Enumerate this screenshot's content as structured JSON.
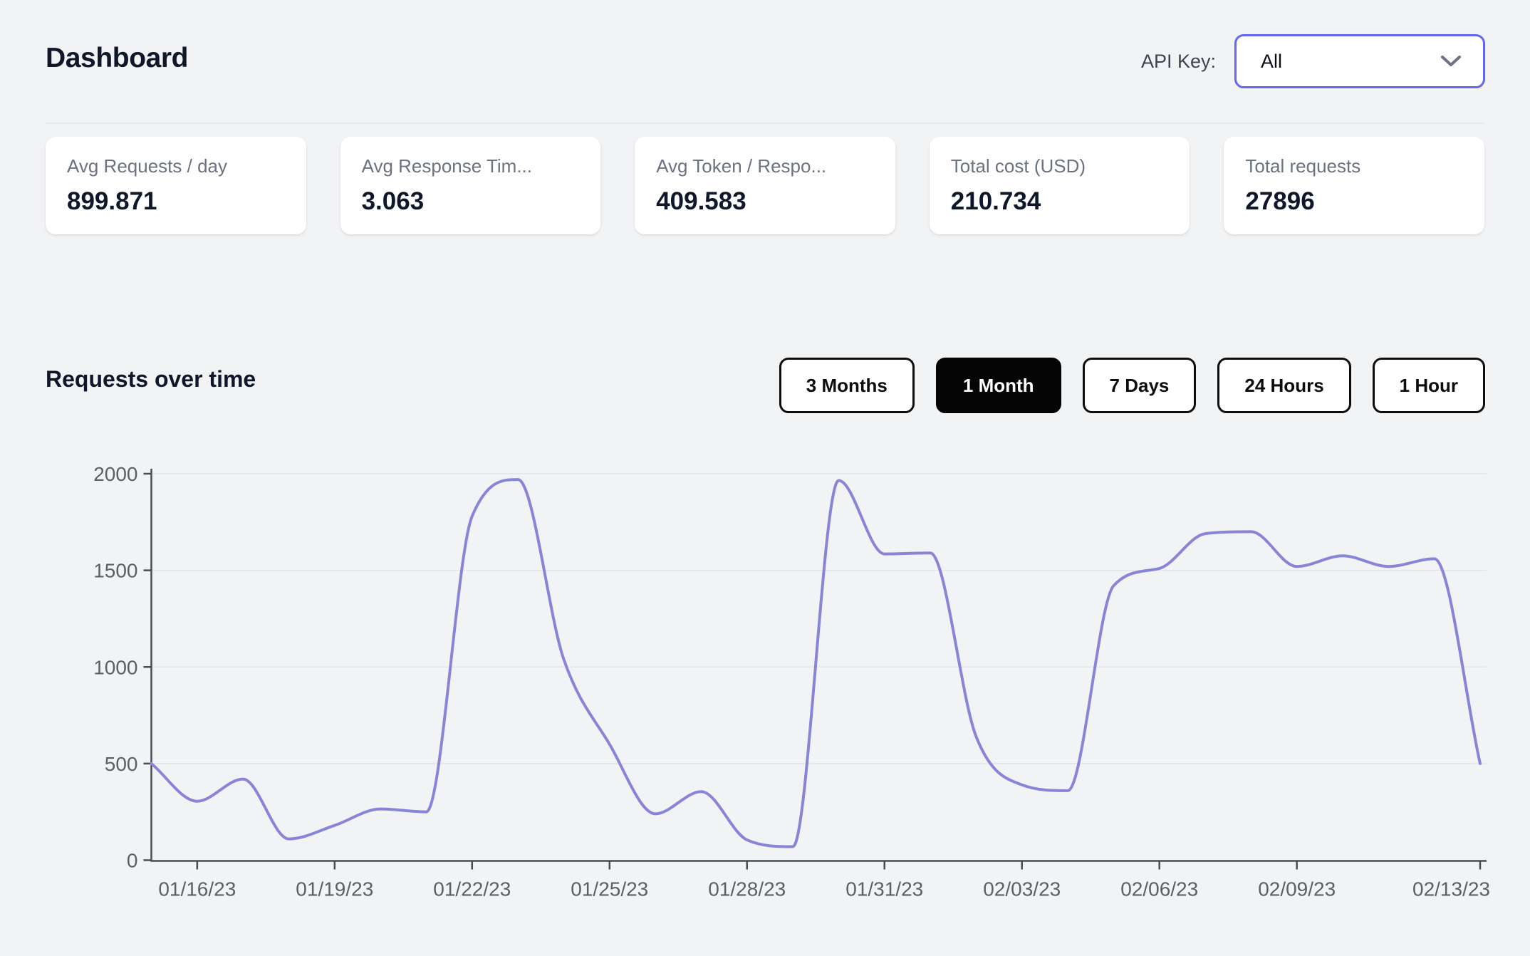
{
  "theme": {
    "background": "#f2f3f5",
    "accent": "#6366f1",
    "active_button_bg": "#050505"
  },
  "header": {
    "title": "Dashboard",
    "api_key_label": "API Key:",
    "api_key_value": "All"
  },
  "stats": [
    {
      "label": "Avg Requests / day",
      "value": "899.871"
    },
    {
      "label": "Avg Response Tim...",
      "value": "3.063"
    },
    {
      "label": "Avg Token / Respo...",
      "value": "409.583"
    },
    {
      "label": "Total cost (USD)",
      "value": "210.734"
    },
    {
      "label": "Total requests",
      "value": "27896"
    }
  ],
  "section": {
    "title": "Requests over time",
    "ranges": [
      {
        "label": "3 Months",
        "active": false
      },
      {
        "label": "1 Month",
        "active": true
      },
      {
        "label": "7 Days",
        "active": false
      },
      {
        "label": "24 Hours",
        "active": false
      },
      {
        "label": "1 Hour",
        "active": false
      }
    ]
  },
  "chart_data": {
    "type": "line",
    "title": "Requests over time",
    "x": [
      "01/15/23",
      "01/16/23",
      "01/17/23",
      "01/18/23",
      "01/19/23",
      "01/20/23",
      "01/21/23",
      "01/22/23",
      "01/23/23",
      "01/24/23",
      "01/25/23",
      "01/26/23",
      "01/27/23",
      "01/28/23",
      "01/29/23",
      "01/30/23",
      "01/31/23",
      "02/01/23",
      "02/02/23",
      "02/03/23",
      "02/04/23",
      "02/05/23",
      "02/06/23",
      "02/07/23",
      "02/08/23",
      "02/09/23",
      "02/10/23",
      "02/11/23",
      "02/12/23",
      "02/13/23"
    ],
    "values": [
      500,
      305,
      420,
      110,
      180,
      265,
      250,
      1780,
      1970,
      1040,
      600,
      240,
      355,
      105,
      70,
      1965,
      1585,
      1590,
      640,
      390,
      360,
      1420,
      1510,
      1690,
      1700,
      1520,
      1575,
      1520,
      1560,
      500
    ],
    "x_ticks": [
      "01/16/23",
      "01/19/23",
      "01/22/23",
      "01/25/23",
      "01/28/23",
      "01/31/23",
      "02/03/23",
      "02/06/23",
      "02/09/23",
      "02/13/23"
    ],
    "y_ticks": [
      0,
      500,
      1000,
      1500,
      2000
    ],
    "ylim": [
      0,
      2000
    ],
    "xlabel": "",
    "ylabel": "",
    "legend": "none",
    "grid": "horizontal",
    "line_color": "#8884d8",
    "axis_color": "#474d54",
    "tick_text_color": "#5a6068",
    "grid_color": "#e3e5e9",
    "curve": "monotone"
  }
}
